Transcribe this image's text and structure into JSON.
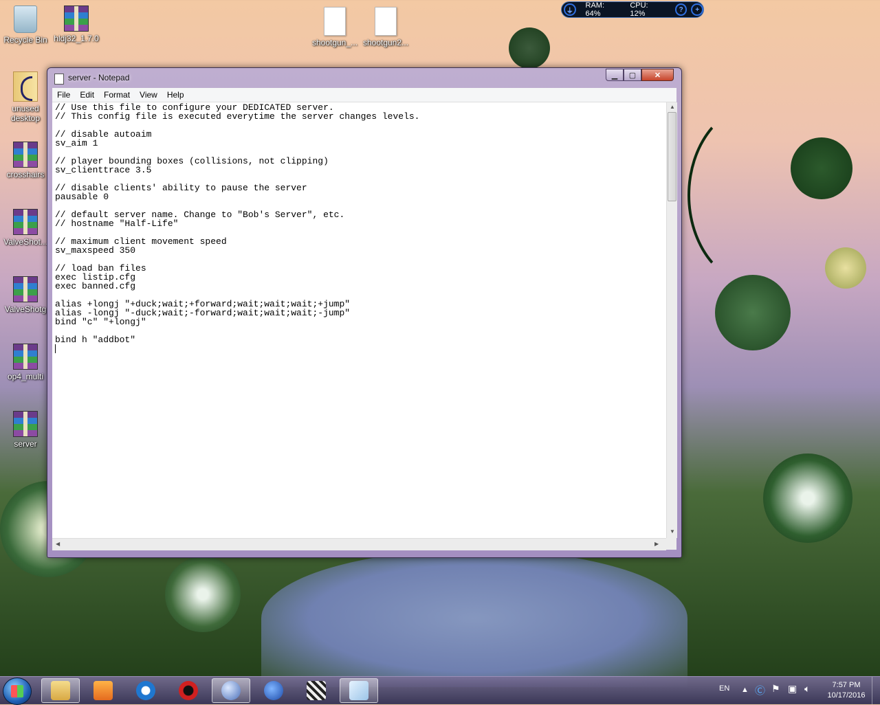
{
  "desktop_icons": [
    {
      "label": "Recycle Bin"
    },
    {
      "label": "hldj32_1.7.0"
    },
    {
      "label": "shootgun_..."
    },
    {
      "label": "shootgun2..."
    },
    {
      "label": "unused desktop"
    },
    {
      "label": "crosshairs"
    },
    {
      "label": "ValveShot..."
    },
    {
      "label": "ValveShotg"
    },
    {
      "label": "op4_multi"
    },
    {
      "label": "server"
    }
  ],
  "gadget": {
    "ram": "RAM: 64%",
    "cpu": "CPU: 12%"
  },
  "window": {
    "title": "server - Notepad",
    "minimize": "▁",
    "maximize": "▢",
    "close": "✕"
  },
  "menu": [
    "File",
    "Edit",
    "Format",
    "View",
    "Help"
  ],
  "editor": {
    "lines": [
      "// Use this file to configure your DEDICATED server.",
      "// This config file is executed everytime the server changes levels.",
      "",
      "// disable autoaim",
      "sv_aim 1",
      "",
      "// player bounding boxes (collisions, not clipping)",
      "sv_clienttrace 3.5",
      "",
      "// disable clients' ability to pause the server",
      "pausable 0",
      "",
      "// default server name. Change to \"Bob's Server\", etc.",
      "// hostname \"Half-Life\"",
      "",
      "// maximum client movement speed",
      "sv_maxspeed 350",
      "",
      "// load ban files",
      "exec listip.cfg",
      "exec banned.cfg",
      "",
      "alias +longj \"+duck;wait;+forward;wait;wait;wait;+jump\"",
      "alias -longj \"-duck;wait;-forward;wait;wait;wait;-jump\"",
      "bind \"c\" \"+longj\"",
      "",
      "bind h \"addbot\"",
      ""
    ]
  },
  "taskbar": {
    "language": "EN",
    "time": "7:57 PM",
    "date": "10/17/2016"
  }
}
